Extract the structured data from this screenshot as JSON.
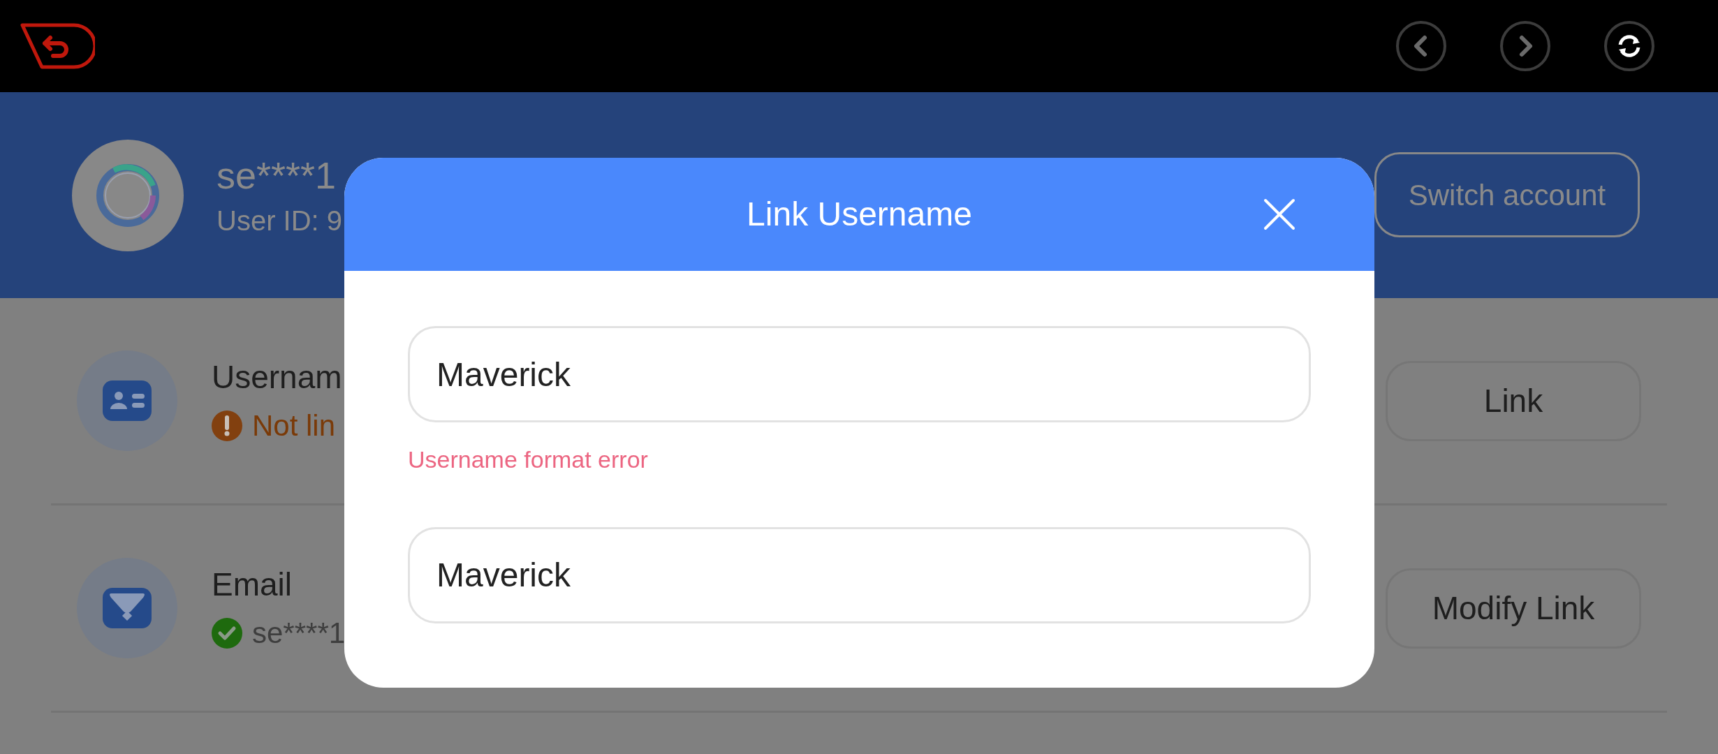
{
  "account": {
    "name": "se****1",
    "user_id": "User ID: 9",
    "switch_button": "Switch account"
  },
  "bindings": [
    {
      "kind": "username",
      "title": "Usernam",
      "status": "Not lin",
      "linked": false,
      "button": "Link"
    },
    {
      "kind": "email",
      "title": "Email",
      "status": "se****1",
      "linked": true,
      "button": "Modify Link"
    }
  ],
  "dialog": {
    "title": "Link Username",
    "fields": [
      {
        "value": "Maverick",
        "error": "Username format error"
      },
      {
        "value": "Maverick"
      }
    ]
  }
}
